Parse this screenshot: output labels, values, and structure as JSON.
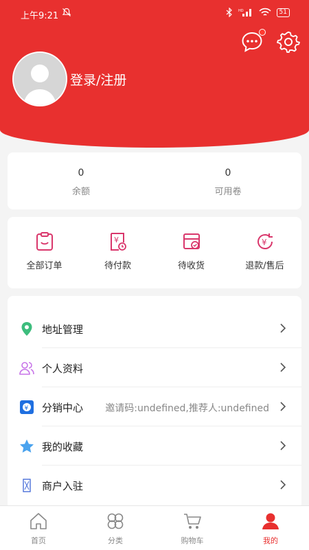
{
  "status_bar": {
    "time": "上午9:21",
    "battery": "51"
  },
  "header": {
    "login_label": "登录/注册"
  },
  "stats": [
    {
      "value": "0",
      "label": "余额"
    },
    {
      "value": "0",
      "label": "可用卷"
    }
  ],
  "orders": [
    {
      "label": "全部订单",
      "icon": "clipboard-icon"
    },
    {
      "label": "待付款",
      "icon": "yen-receipt-icon"
    },
    {
      "label": "待收货",
      "icon": "package-check-icon"
    },
    {
      "label": "退款/售后",
      "icon": "yen-refund-icon"
    }
  ],
  "menu": [
    {
      "label": "地址管理",
      "icon": "location-pin-icon",
      "extra": ""
    },
    {
      "label": "个人资料",
      "icon": "users-icon",
      "extra": ""
    },
    {
      "label": "分销中心",
      "icon": "distribution-icon",
      "extra": "邀请码:undefined,推荐人:undefined"
    },
    {
      "label": "我的收藏",
      "icon": "star-icon",
      "extra": ""
    },
    {
      "label": "商户入驻",
      "icon": "merchant-icon",
      "extra": ""
    }
  ],
  "tabs": [
    {
      "label": "首页",
      "icon": "home-icon"
    },
    {
      "label": "分类",
      "icon": "category-icon"
    },
    {
      "label": "购物车",
      "icon": "cart-icon"
    },
    {
      "label": "我的",
      "icon": "profile-icon",
      "active": true
    }
  ],
  "colors": {
    "brand": "#e8302f",
    "accent_pink": "#d9366b",
    "pin_green": "#3dbd7d",
    "star_blue": "#4aa3ee",
    "user_purple": "#c774e8",
    "dist_blue": "#1f6fe0"
  }
}
